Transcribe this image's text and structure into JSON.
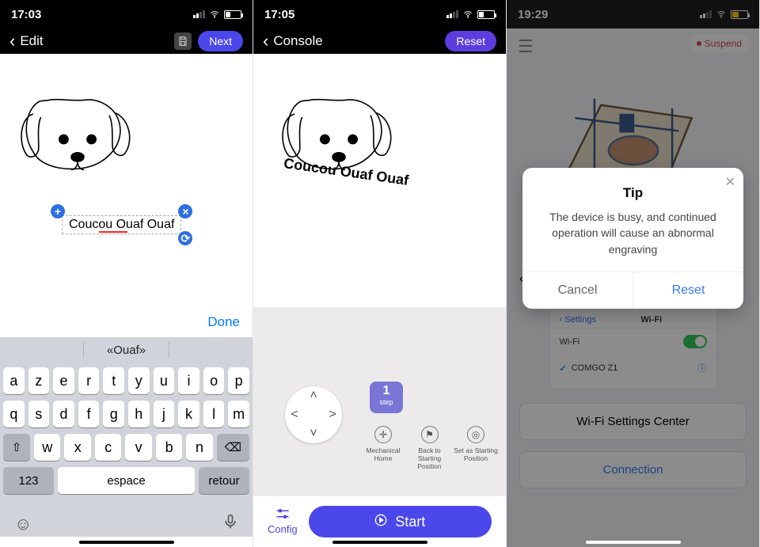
{
  "pane1": {
    "status": {
      "time": "17:03"
    },
    "nav": {
      "title": "Edit",
      "next": "Next"
    },
    "text_value": "Coucou Ouaf Ouaf",
    "kb": {
      "done": "Done",
      "suggestion": "«Ouaf»",
      "row1": [
        "a",
        "z",
        "e",
        "r",
        "t",
        "y",
        "u",
        "i",
        "o",
        "p"
      ],
      "row2": [
        "q",
        "s",
        "d",
        "f",
        "g",
        "h",
        "j",
        "k",
        "l",
        "m"
      ],
      "row3": [
        "w",
        "x",
        "c",
        "v",
        "b",
        "n"
      ],
      "shift": "⇧",
      "backspace": "⌫",
      "numbers": "123",
      "space": "espace",
      "return": "retour"
    }
  },
  "pane2": {
    "status": {
      "time": "17:05"
    },
    "nav": {
      "title": "Console",
      "reset": "Reset"
    },
    "text_value": "Coucou Ouaf Ouaf",
    "step": {
      "value": "1",
      "label": "step"
    },
    "tools": {
      "home": "Mechanical Home",
      "back": "Back to Starting Position",
      "set": "Set as Starting Position"
    },
    "config": "Config",
    "start": "Start"
  },
  "pane3": {
    "status": {
      "time": "19:29"
    },
    "suspend": "Suspend",
    "back": "Back",
    "wifi": {
      "settings": "Settings",
      "header": "Wi-Fi",
      "row_label": "Wi-Fi",
      "network": "COMGO Z1"
    },
    "btn_wifi": "Wi-Fi Settings Center",
    "btn_conn": "Connection",
    "modal": {
      "title": "Tip",
      "msg": "The device is busy, and continued operation will cause an abnormal engraving",
      "cancel": "Cancel",
      "reset": "Reset"
    }
  }
}
